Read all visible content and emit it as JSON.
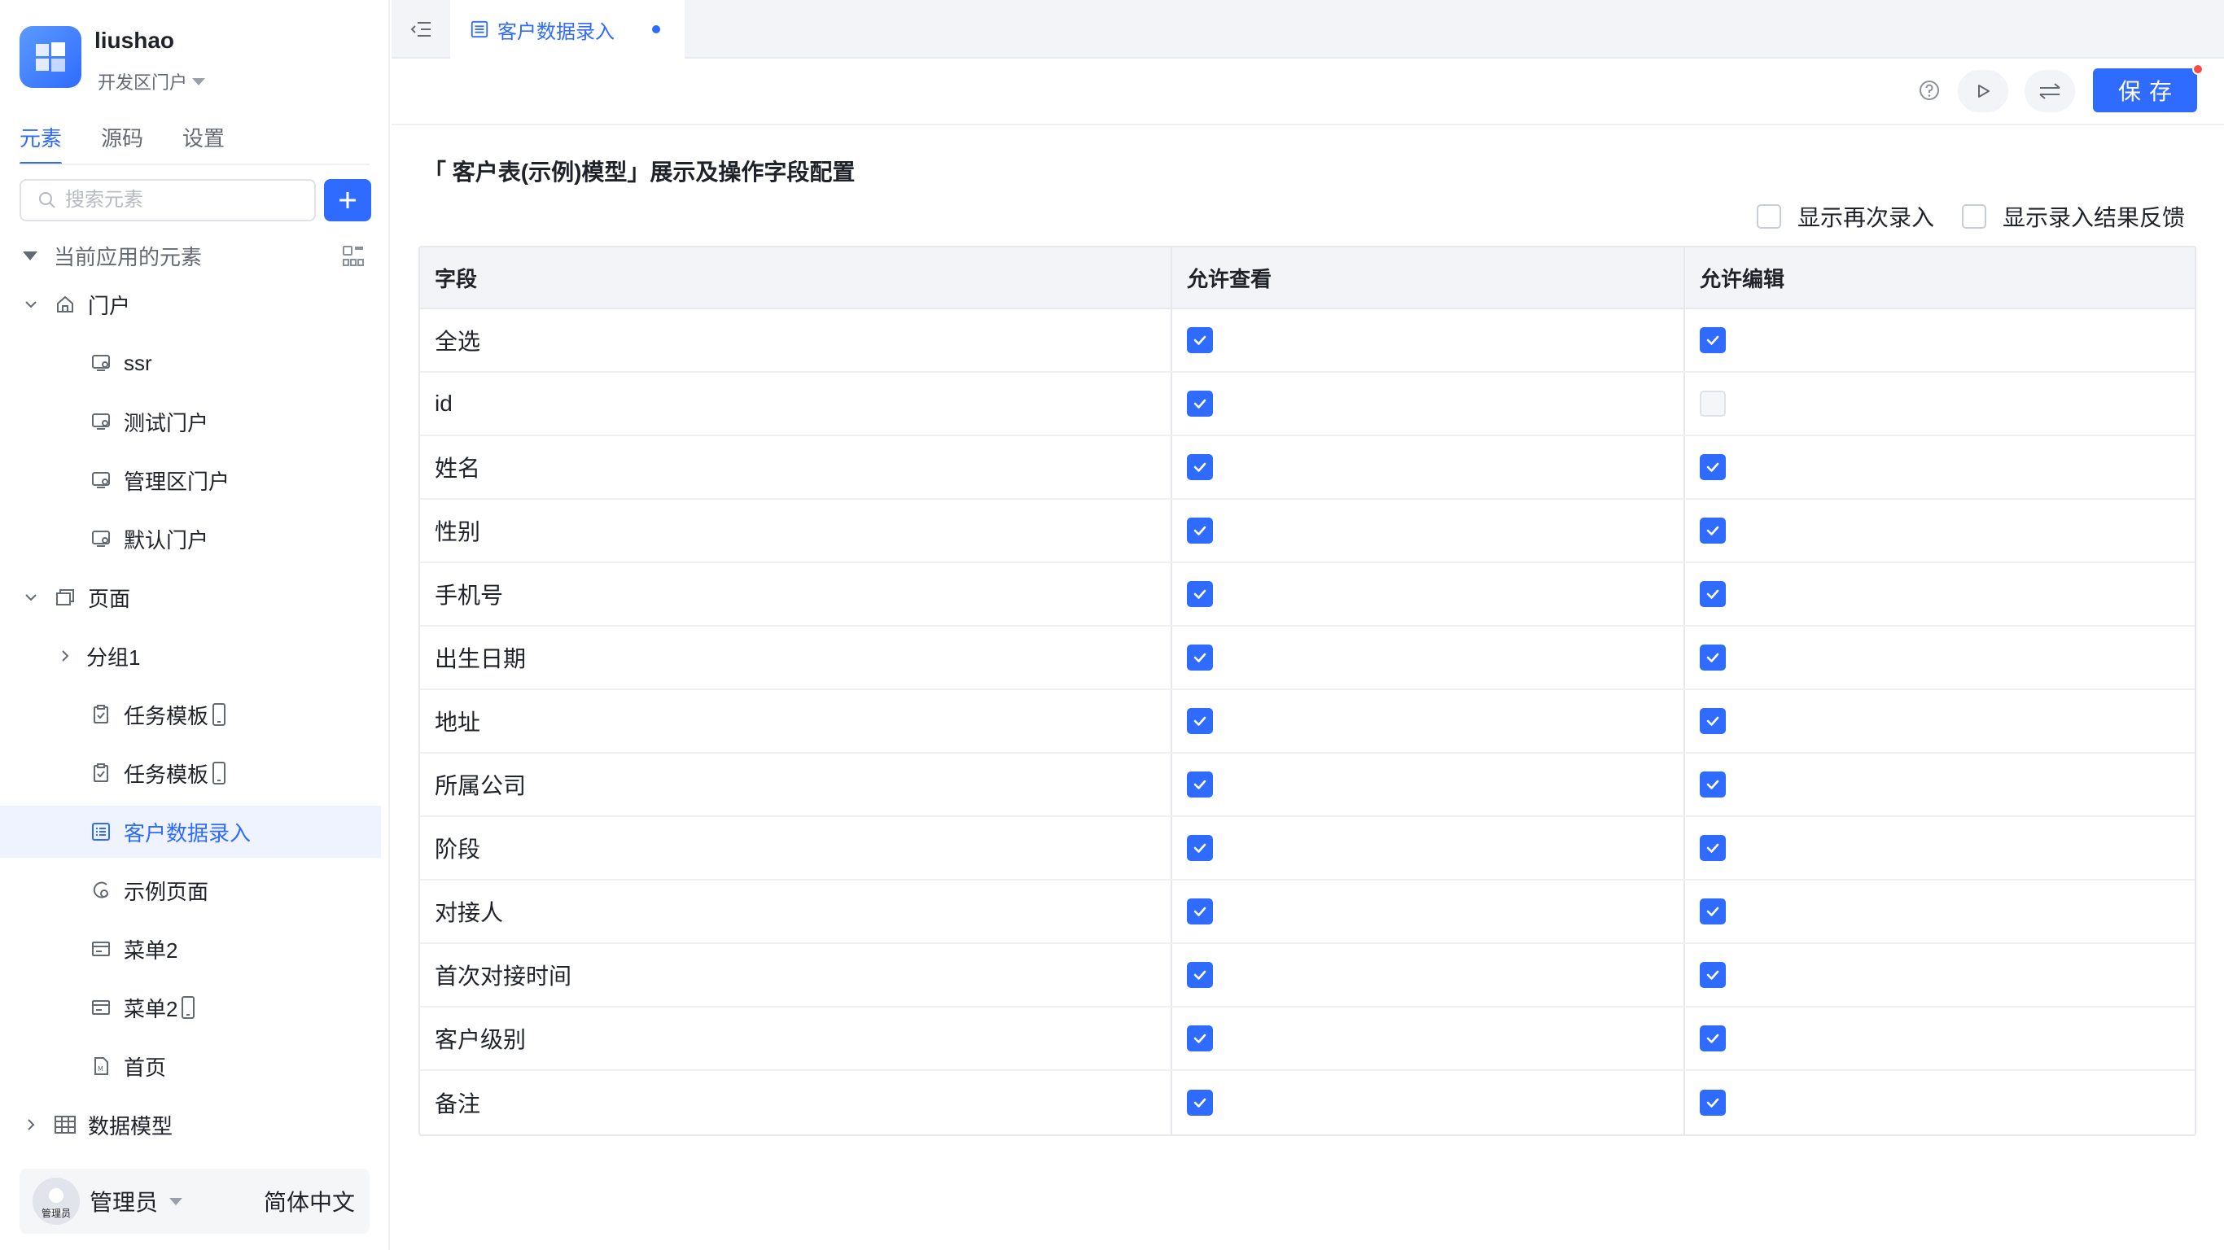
{
  "app": {
    "name": "liushao",
    "portal": "开发区门户"
  },
  "sidebar": {
    "tabs": [
      "元素",
      "源码",
      "设置"
    ],
    "search_placeholder": "搜索元素",
    "section_title": "当前应用的元素",
    "tree": [
      {
        "label": "门户",
        "icon": "home-icon",
        "level": 0,
        "expanded": true
      },
      {
        "label": "ssr",
        "icon": "portal-icon",
        "level": 1
      },
      {
        "label": "测试门户",
        "icon": "portal-icon",
        "level": 1
      },
      {
        "label": "管理区门户",
        "icon": "portal-icon",
        "level": 1
      },
      {
        "label": "默认门户",
        "icon": "portal-icon",
        "level": 1
      },
      {
        "label": "页面",
        "icon": "pages-icon",
        "level": 0,
        "expanded": true
      },
      {
        "label": "分组1",
        "icon": "",
        "level": 1,
        "collapsed": true
      },
      {
        "label": "任务模板",
        "icon": "task-icon",
        "level": 1,
        "mobile": true
      },
      {
        "label": "任务模板",
        "icon": "task-icon",
        "level": 1,
        "mobile": true
      },
      {
        "label": "客户数据录入",
        "icon": "form-icon",
        "level": 1,
        "selected": true
      },
      {
        "label": "示例页面",
        "icon": "example-page-icon",
        "level": 1
      },
      {
        "label": "菜单2",
        "icon": "menu-icon",
        "level": 1
      },
      {
        "label": "菜单2",
        "icon": "menu-icon",
        "level": 1,
        "mobile": true
      },
      {
        "label": "首页",
        "icon": "doc-icon",
        "level": 1
      },
      {
        "label": "数据模型",
        "icon": "table-icon",
        "level": 0,
        "collapsed": true
      }
    ],
    "user": {
      "avatar_label": "管理员",
      "name": "管理员",
      "language": "简体中文"
    }
  },
  "tabbar": {
    "active_tab": "客户数据录入"
  },
  "toolbar": {
    "save_label": "保存"
  },
  "main": {
    "title": "「 客户表(示例)模型」展示及操作字段配置",
    "options": [
      {
        "label": "显示再次录入",
        "checked": false
      },
      {
        "label": "显示录入结果反馈",
        "checked": false
      }
    ],
    "columns": [
      "字段",
      "允许查看",
      "允许编辑"
    ],
    "rows": [
      {
        "field": "全选",
        "view": true,
        "edit": true
      },
      {
        "field": "id",
        "view": true,
        "edit": false
      },
      {
        "field": "姓名",
        "view": true,
        "edit": true
      },
      {
        "field": "性别",
        "view": true,
        "edit": true
      },
      {
        "field": "手机号",
        "view": true,
        "edit": true
      },
      {
        "field": "出生日期",
        "view": true,
        "edit": true
      },
      {
        "field": "地址",
        "view": true,
        "edit": true
      },
      {
        "field": "所属公司",
        "view": true,
        "edit": true
      },
      {
        "field": "阶段",
        "view": true,
        "edit": true
      },
      {
        "field": "对接人",
        "view": true,
        "edit": true
      },
      {
        "field": "首次对接时间",
        "view": true,
        "edit": true
      },
      {
        "field": "客户级别",
        "view": true,
        "edit": true
      },
      {
        "field": "备注",
        "view": true,
        "edit": true
      }
    ]
  },
  "colors": {
    "accent": "#2f6bff",
    "badge": "#f54a45"
  }
}
